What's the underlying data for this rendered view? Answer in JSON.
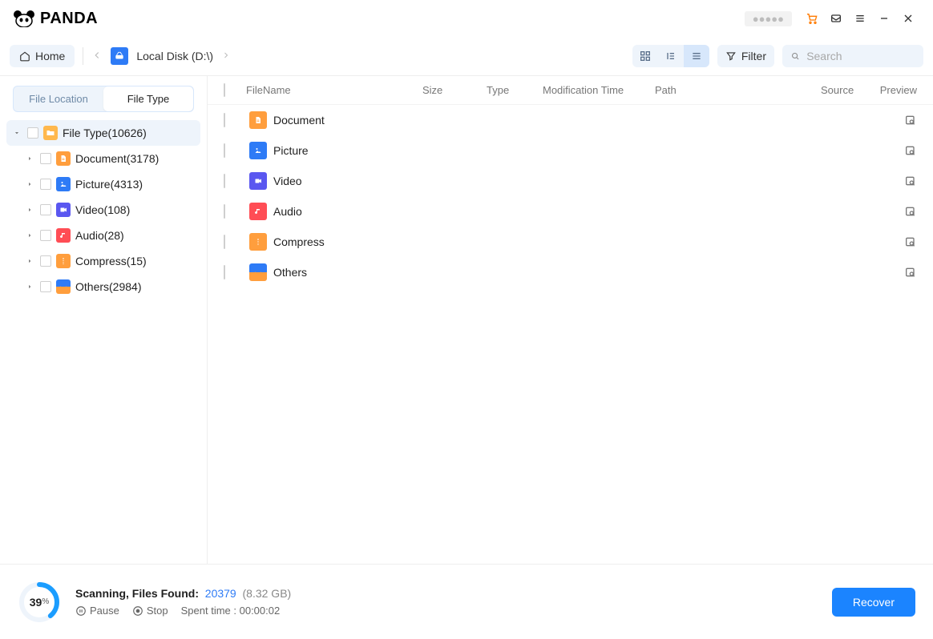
{
  "app": {
    "name": "PANDA"
  },
  "titlebar": {
    "user_label": "●●●●●"
  },
  "toolbar": {
    "home": "Home",
    "location": "Local Disk (D:\\)",
    "filter": "Filter",
    "search_placeholder": "Search"
  },
  "sidebar": {
    "tabs": {
      "location": "File Location",
      "filetype": "File Type"
    },
    "root": {
      "label": "File Type",
      "count": "(10626)"
    },
    "items": [
      {
        "label": "Document",
        "count": "(3178)",
        "icon": "doc"
      },
      {
        "label": "Picture",
        "count": "(4313)",
        "icon": "pic"
      },
      {
        "label": "Video",
        "count": "(108)",
        "icon": "vid"
      },
      {
        "label": "Audio",
        "count": "(28)",
        "icon": "aud"
      },
      {
        "label": "Compress",
        "count": "(15)",
        "icon": "zip"
      },
      {
        "label": "Others",
        "count": "(2984)",
        "icon": "oth"
      }
    ]
  },
  "table": {
    "headers": {
      "name": "FileName",
      "size": "Size",
      "type": "Type",
      "mod": "Modification Time",
      "path": "Path",
      "src": "Source",
      "prev": "Preview"
    },
    "rows": [
      {
        "label": "Document",
        "icon": "doc"
      },
      {
        "label": "Picture",
        "icon": "pic"
      },
      {
        "label": "Video",
        "icon": "vid"
      },
      {
        "label": "Audio",
        "icon": "aud"
      },
      {
        "label": "Compress",
        "icon": "zip"
      },
      {
        "label": "Others",
        "icon": "oth"
      }
    ]
  },
  "status": {
    "percent": "39",
    "unit": "%",
    "scanning": "Scanning, Files Found:",
    "count": "20379",
    "size": "(8.32 GB)",
    "pause": "Pause",
    "stop": "Stop",
    "spent_label": "Spent time : ",
    "spent": "00:00:02",
    "recover": "Recover"
  }
}
